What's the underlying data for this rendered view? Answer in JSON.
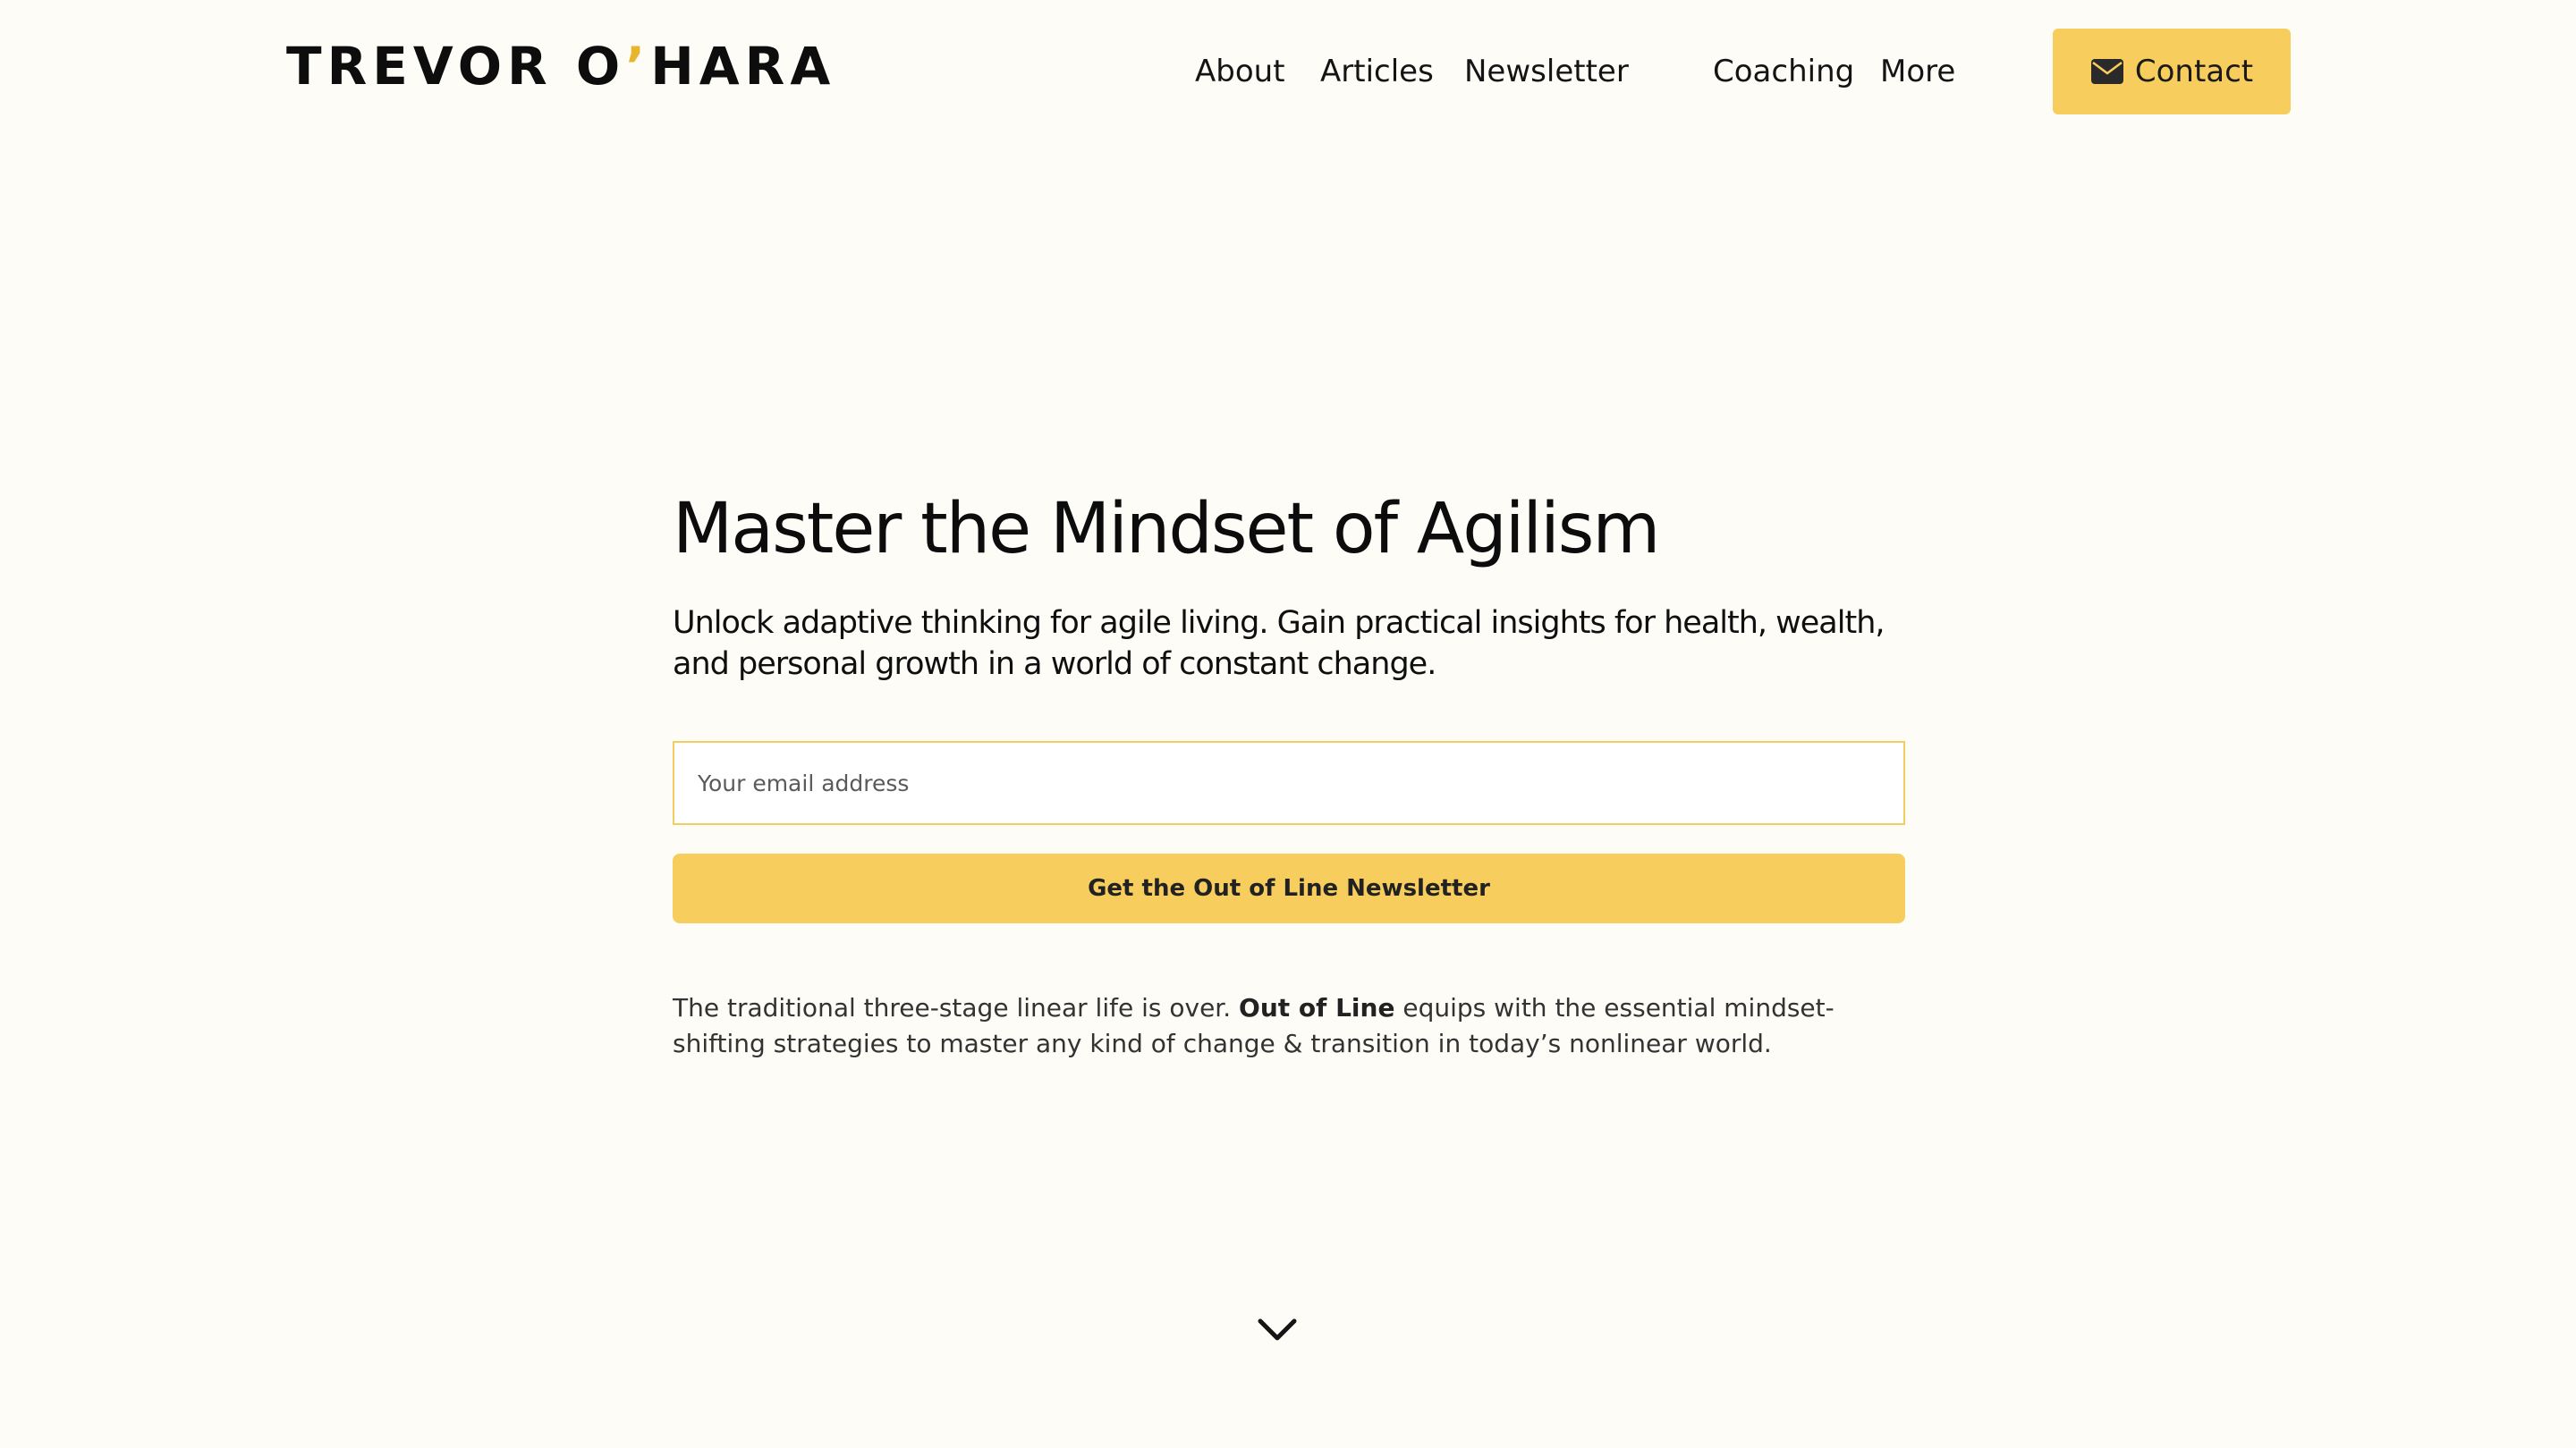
{
  "header": {
    "logo": {
      "part1": "TREVOR O",
      "apostrophe": "’",
      "part2": "HARA"
    },
    "nav": {
      "about": "About",
      "articles": "Articles",
      "newsletter": "Newsletter",
      "coaching": "Coaching",
      "more": "More"
    },
    "contact_label": "Contact"
  },
  "hero": {
    "title": "Master the Mindset of Agilism",
    "subtitle": "Unlock adaptive thinking for agile living. Gain practical insights for health, wealth, and personal growth in a world of constant change.",
    "email_placeholder": "Your email address",
    "email_value": "",
    "submit_label": "Get the Out of Line Newsletter",
    "description_before": "The traditional three-stage linear life is over. ",
    "description_bold": "Out of Line",
    "description_after": " equips with the essential mindset-shifting strategies to master any kind of change & transition in today’s nonlinear world."
  },
  "icons": {
    "contact": "envelope-icon",
    "scroll": "chevron-down-icon"
  },
  "colors": {
    "background": "#fdfcf7",
    "accent": "#f7cd5e",
    "logo_apostrophe": "#e9b52c",
    "text": "#111111"
  }
}
